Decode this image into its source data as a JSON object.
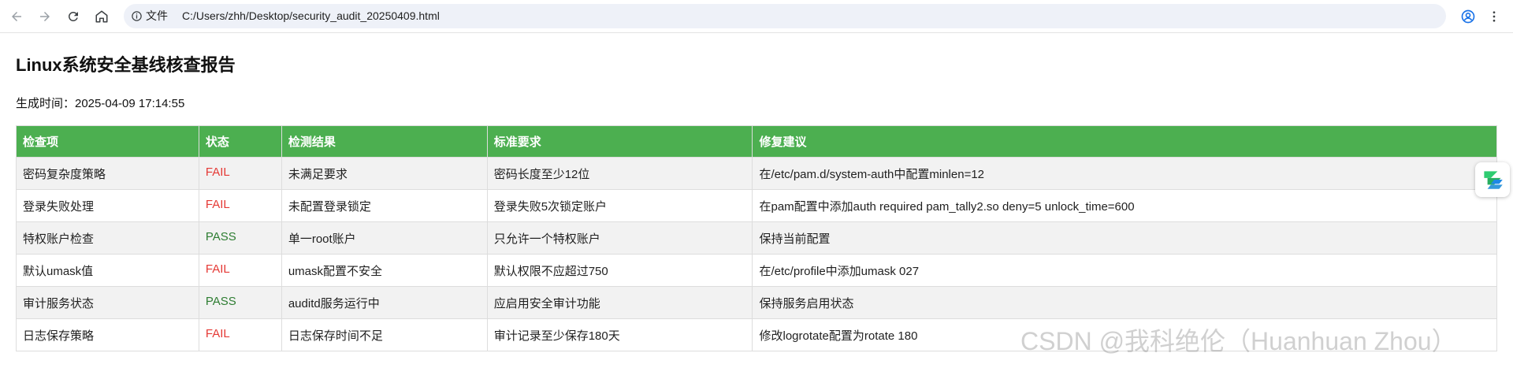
{
  "browser": {
    "file_label": "文件",
    "url": "C:/Users/zhh/Desktop/security_audit_20250409.html",
    "icons": [
      "back-icon",
      "forward-icon",
      "reload-icon",
      "home-icon",
      "info-icon",
      "star-icon",
      "profile-icon",
      "more-menu-icon"
    ]
  },
  "page": {
    "title": "Linux系统安全基线核查报告",
    "generated": "生成时间：2025-04-09 17:14:55"
  },
  "table": {
    "headers": [
      "检查项",
      "状态",
      "检测结果",
      "标准要求",
      "修复建议"
    ],
    "rows": [
      [
        "密码复杂度策略",
        "FAIL",
        "未满足要求",
        "密码长度至少12位",
        "在/etc/pam.d/system-auth中配置minlen=12"
      ],
      [
        "登录失败处理",
        "FAIL",
        "未配置登录锁定",
        "登录失败5次锁定账户",
        "在pam配置中添加auth required pam_tally2.so deny=5 unlock_time=600"
      ],
      [
        "特权账户检查",
        "PASS",
        "单一root账户",
        "只允许一个特权账户",
        "保持当前配置"
      ],
      [
        "默认umask值",
        "FAIL",
        "umask配置不安全",
        "默认权限不应超过750",
        "在/etc/profile中添加umask 027"
      ],
      [
        "审计服务状态",
        "PASS",
        "auditd服务运行中",
        "应启用安全审计功能",
        "保持服务启用状态"
      ],
      [
        "日志保存策略",
        "FAIL",
        "日志保存时间不足",
        "审计记录至少保存180天",
        "修改logrotate配置为rotate 180"
      ]
    ]
  },
  "colors": {
    "header_bg": "#4caf50",
    "fail": "#e53935",
    "pass": "#2e7d32",
    "row_alt": "#f2f2f2"
  },
  "watermark": "CSDN @我科绝伦（Huanhuan Zhou）"
}
